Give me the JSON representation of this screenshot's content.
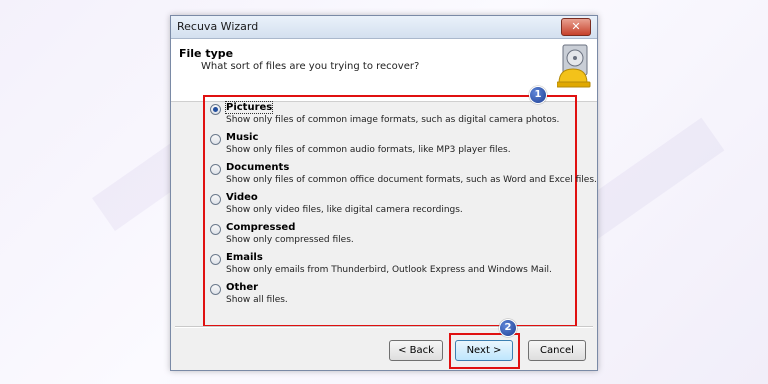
{
  "window": {
    "title": "Recuva Wizard",
    "close_glyph": "✕"
  },
  "header": {
    "title": "File type",
    "subtitle": "What sort of files are you trying to recover?",
    "icon": "hard-drive-helmet-icon"
  },
  "options": [
    {
      "label": "Pictures",
      "description": "Show only files of common image formats, such as digital camera photos.",
      "selected": true
    },
    {
      "label": "Music",
      "description": "Show only files of common audio formats, like MP3 player files.",
      "selected": false
    },
    {
      "label": "Documents",
      "description": "Show only files of common office document formats, such as Word and Excel files.",
      "selected": false
    },
    {
      "label": "Video",
      "description": "Show only video files, like digital camera recordings.",
      "selected": false
    },
    {
      "label": "Compressed",
      "description": "Show only compressed files.",
      "selected": false
    },
    {
      "label": "Emails",
      "description": "Show only emails from Thunderbird, Outlook Express and Windows Mail.",
      "selected": false
    },
    {
      "label": "Other",
      "description": "Show all files.",
      "selected": false
    }
  ],
  "annotations": {
    "badge_1": "1",
    "badge_2": "2",
    "highlight_color": "#e01010"
  },
  "buttons": {
    "back": "< Back",
    "next": "Next >",
    "cancel": "Cancel"
  }
}
